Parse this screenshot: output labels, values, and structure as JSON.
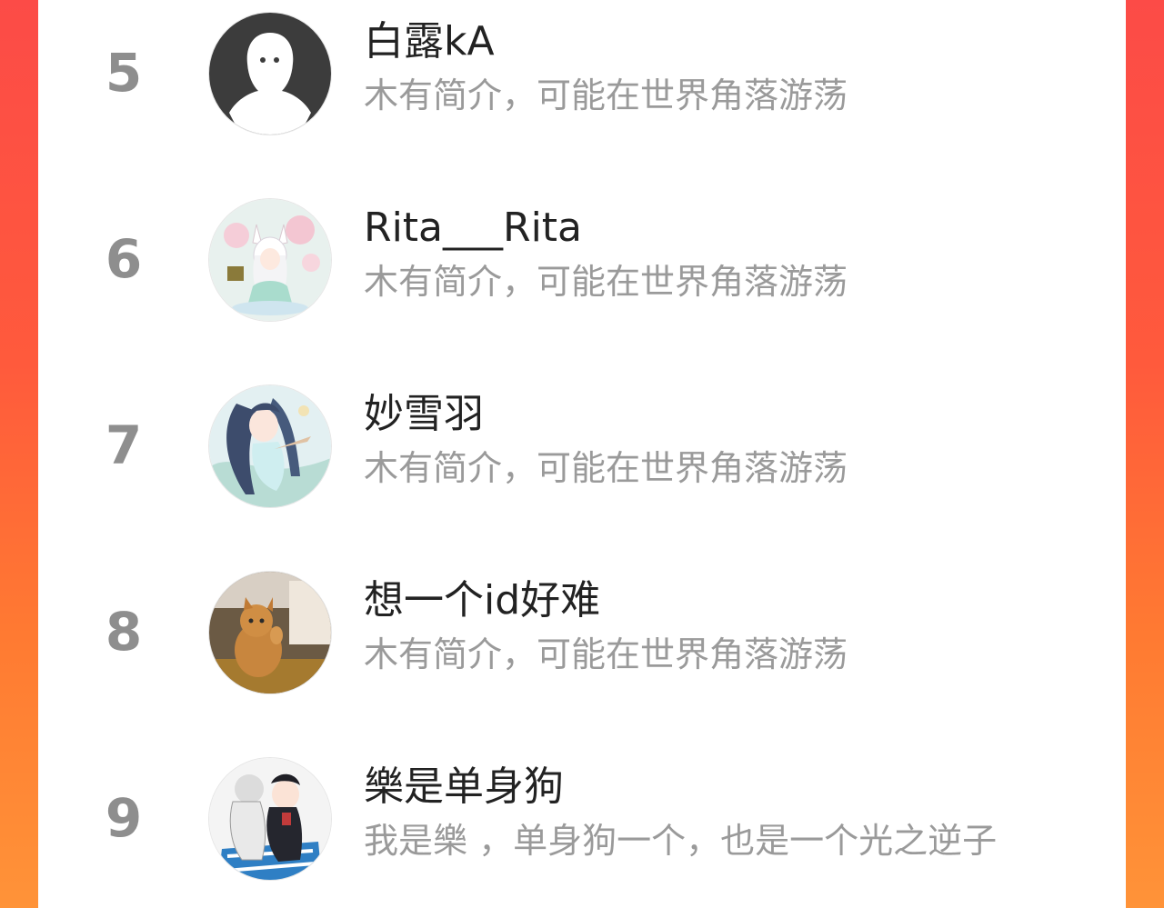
{
  "ranking": {
    "items": [
      {
        "rank": "5",
        "name": "白露kA",
        "bio": "木有简介，可能在世界角落游荡",
        "avatar_icon": "default-ghost-avatar"
      },
      {
        "rank": "6",
        "name": "Rita___Rita",
        "bio": "木有简介，可能在世界角落游荡",
        "avatar_icon": "anime-fox-girl-avatar"
      },
      {
        "rank": "7",
        "name": "妙雪羽",
        "bio": "木有简介，可能在世界角落游荡",
        "avatar_icon": "anime-girl-avatar"
      },
      {
        "rank": "8",
        "name": "想一个id好难",
        "bio": "木有简介，可能在世界角落游荡",
        "avatar_icon": "orange-cat-avatar"
      },
      {
        "rank": "9",
        "name": "樂是单身狗",
        "bio": "我是樂 ，单身狗一个，也是一个光之逆子",
        "avatar_icon": "anime-boys-avatar"
      }
    ]
  },
  "colors": {
    "background_top": "#fc4b47",
    "background_bottom": "#ff9338",
    "rank_color": "#8e8e8e",
    "name_color": "#222222",
    "bio_color": "#9a9a9a"
  }
}
